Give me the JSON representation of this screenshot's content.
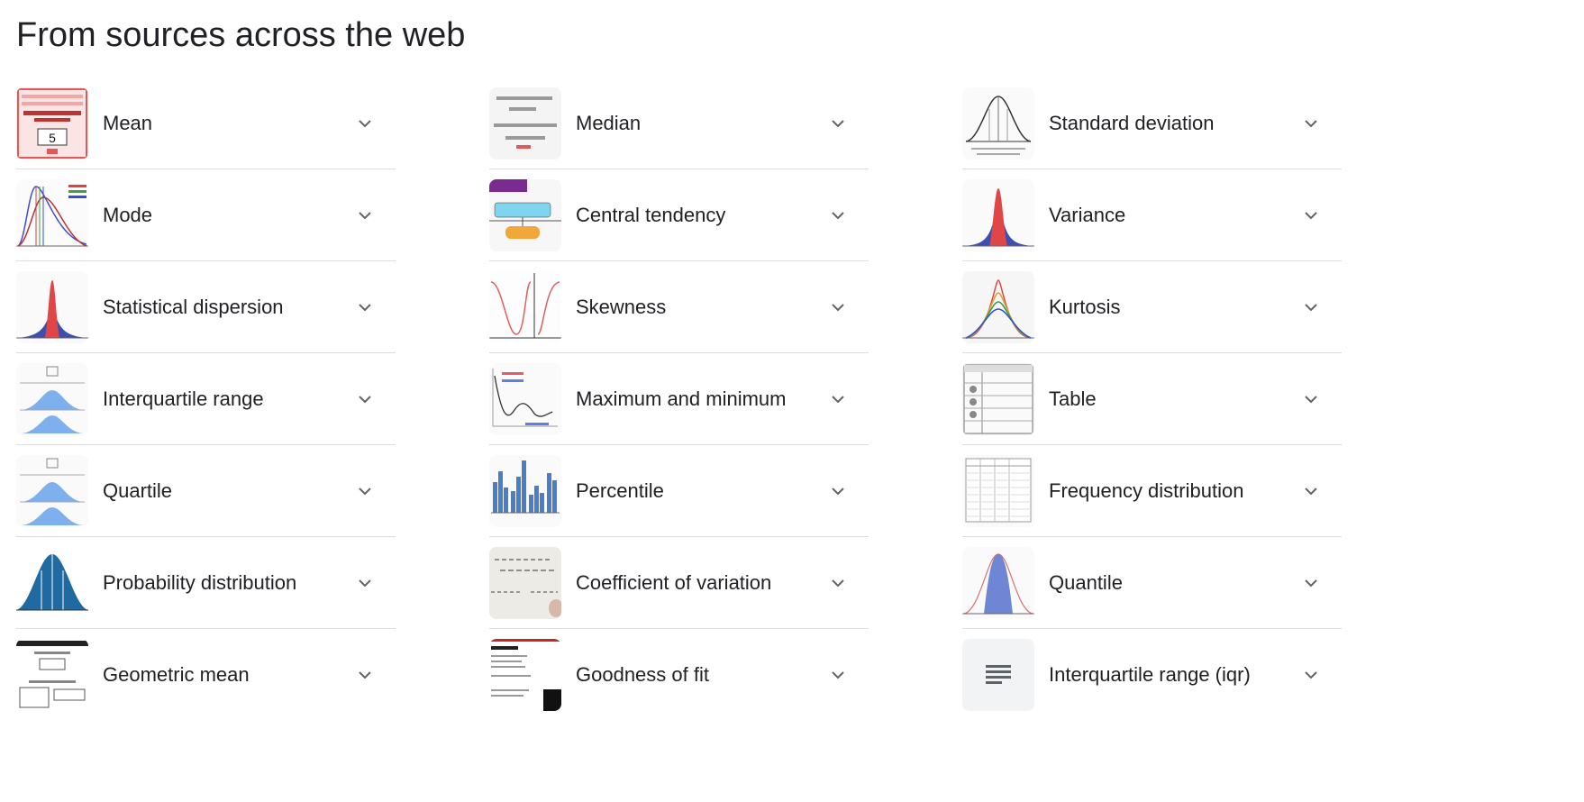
{
  "heading": "From sources across the web",
  "columns": [
    {
      "items": [
        {
          "label": "Mean",
          "thumb": "mean-thumbnail"
        },
        {
          "label": "Mode",
          "thumb": "mode-thumbnail"
        },
        {
          "label": "Statistical dispersion",
          "thumb": "dispersion-thumbnail"
        },
        {
          "label": "Interquartile range",
          "thumb": "interquartile-thumbnail"
        },
        {
          "label": "Quartile",
          "thumb": "quartile-thumbnail"
        },
        {
          "label": "Probability distribution",
          "thumb": "probability-thumbnail"
        },
        {
          "label": "Geometric mean",
          "thumb": "geometric-mean-thumbnail"
        }
      ]
    },
    {
      "items": [
        {
          "label": "Median",
          "thumb": "median-thumbnail"
        },
        {
          "label": "Central tendency",
          "thumb": "central-tendency-thumbnail"
        },
        {
          "label": "Skewness",
          "thumb": "skewness-thumbnail"
        },
        {
          "label": "Maximum and minimum",
          "thumb": "max-min-thumbnail"
        },
        {
          "label": "Percentile",
          "thumb": "percentile-thumbnail"
        },
        {
          "label": "Coefficient of variation",
          "thumb": "coefficient-thumbnail"
        },
        {
          "label": "Goodness of fit",
          "thumb": "goodness-of-fit-thumbnail"
        }
      ]
    },
    {
      "items": [
        {
          "label": "Standard deviation",
          "thumb": "standard-deviation-thumbnail"
        },
        {
          "label": "Variance",
          "thumb": "variance-thumbnail"
        },
        {
          "label": "Kurtosis",
          "thumb": "kurtosis-thumbnail"
        },
        {
          "label": "Table",
          "thumb": "table-thumbnail"
        },
        {
          "label": "Frequency distribution",
          "thumb": "frequency-thumbnail"
        },
        {
          "label": "Quantile",
          "thumb": "quantile-thumbnail"
        },
        {
          "label": "Interquartile range (iqr)",
          "thumb": "notes-icon"
        }
      ]
    }
  ],
  "expand_icon": "chevron-down-icon",
  "colors": {
    "text": "#202124",
    "divider": "#dadce0",
    "icon": "#5f6368"
  }
}
